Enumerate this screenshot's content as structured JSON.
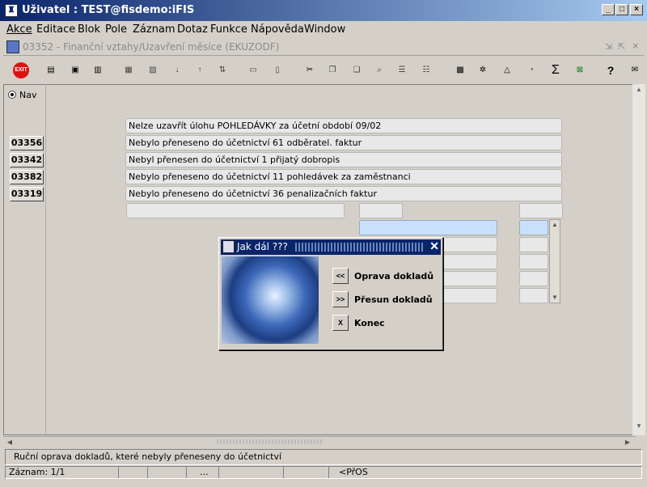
{
  "window": {
    "title": "Uživatel : TEST@fisdemo:iFIS",
    "controls": {
      "minimize": "_",
      "maximize": "□",
      "close": "×"
    }
  },
  "menu": [
    {
      "label": "Akce",
      "hotkey_index": 0
    },
    {
      "label": "Editace",
      "hotkey_index": 0
    },
    {
      "label": "Blok",
      "hotkey_index": 0
    },
    {
      "label": "Pole",
      "hotkey_index": 0
    },
    {
      "label": "Záznam",
      "hotkey_index": 0
    },
    {
      "label": "Dotaz",
      "hotkey_index": 0
    },
    {
      "label": "Funkce",
      "hotkey_index": 0
    },
    {
      "label": "Nápověda",
      "hotkey_index": 0
    },
    {
      "label": "Window",
      "hotkey_index": 0
    }
  ],
  "form": {
    "title": "03352 - Finanční vztahy/Uzavření měsíce (EKUZODF)"
  },
  "toolbar": {
    "exit_label": "EXIT",
    "icons": [
      "exit-icon",
      "add-record-icon",
      "save-record-icon",
      "delete-record-icon",
      "help-icon",
      "list-icon",
      "sort-asc-icon",
      "sort-desc-icon",
      "sort-icon",
      "print-icon",
      "print-preview-icon",
      "cut-icon",
      "copy-icon",
      "paste-icon",
      "search-icon",
      "first-icon",
      "last-icon",
      "calculator-icon",
      "settings-icon",
      "chart-icon",
      "clock-icon",
      "sum-icon",
      "excel-icon",
      "question-icon",
      "mail-icon"
    ],
    "sum_glyph": "Σ",
    "help_glyph": "?"
  },
  "nav": {
    "label": "Nav"
  },
  "header_message": "Nelze uzavřít úlohu   POHLEDÁVKY    za účetní období 09/02",
  "rows": [
    {
      "code": "03356",
      "text": "Nebylo přeneseno do účetnictví 61 odběratel. faktur"
    },
    {
      "code": "03342",
      "text": "Nebyl přenesen do účetnictví 1 přijatý dobropis"
    },
    {
      "code": "03382",
      "text": "Nebylo přeneseno do účetnictví 11 pohledávek za zaměstnanci"
    },
    {
      "code": "03319",
      "text": "Nebylo přeneseno do účetnictví 36 penalizačních faktur"
    }
  ],
  "dialog": {
    "title": "Jak dál ???",
    "buttons": [
      {
        "glyph": "<<",
        "label": "Oprava dokladů"
      },
      {
        "glyph": ">>",
        "label": "Přesun dokladů"
      },
      {
        "glyph": "X",
        "label": "Konec"
      }
    ]
  },
  "status": {
    "message": "Ruční oprava dokladů, které nebyly přeneseny do účetnictví",
    "record": "Záznam: 1/1",
    "ellipsis": "...",
    "mode": "<PřOS"
  }
}
